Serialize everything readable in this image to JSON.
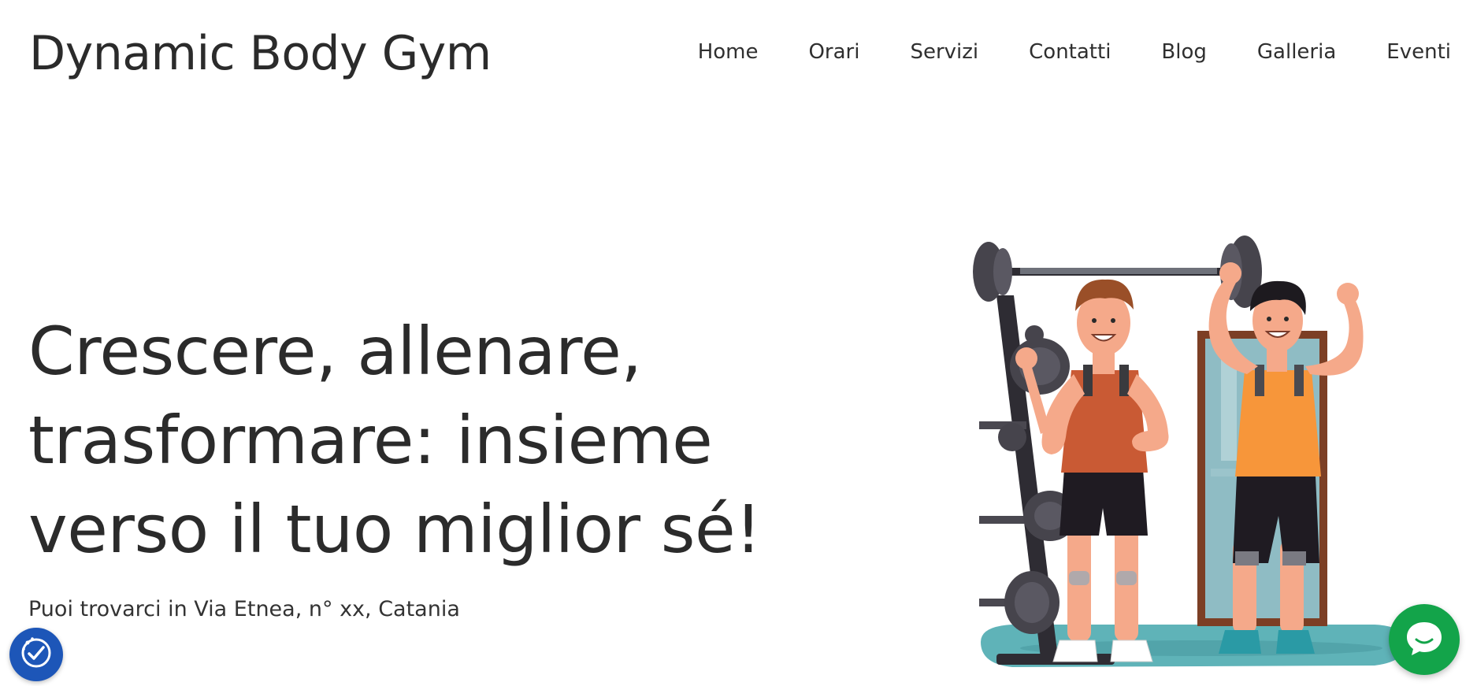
{
  "header": {
    "brand": "Dynamic Body Gym",
    "nav": [
      {
        "label": "Home"
      },
      {
        "label": "Orari"
      },
      {
        "label": "Servizi"
      },
      {
        "label": "Contatti"
      },
      {
        "label": "Blog"
      },
      {
        "label": "Galleria"
      },
      {
        "label": "Eventi"
      }
    ]
  },
  "hero": {
    "title_lines": [
      "Crescere, allenare,",
      "trasformare: insieme",
      "verso il tuo miglior sé!"
    ],
    "address": "Puoi trovarci in Via Etnea, n° xx, Catania"
  },
  "illustration": {
    "icon": "gym-trainers-illustration"
  },
  "floating": {
    "accessibility_icon": "accessibility-icon",
    "chat_icon": "chat-icon"
  },
  "colors": {
    "text": "#2b2b2b",
    "accessibility_bg": "#1d56b8",
    "chat_bg": "#13a44a"
  }
}
